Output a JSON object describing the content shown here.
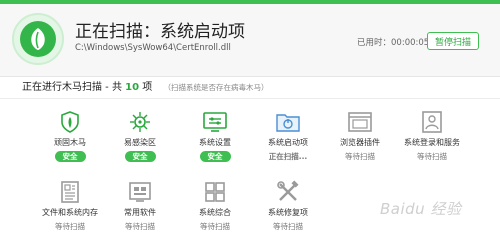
{
  "header": {
    "title": "正在扫描：系统启动项",
    "path": "C:\\Windows\\SysWow64\\CertEnroll.dll",
    "elapsed_label": "已用时：",
    "elapsed_time": "00:00:05",
    "pause_label": "暂停扫描",
    "accent_color": "#3fbf52"
  },
  "status": {
    "prefix": "正在进行木马扫描 - 共",
    "count": "10",
    "suffix": "项",
    "note": "（扫描系统是否存在病毒木马）"
  },
  "items": [
    {
      "label": "顽固木马",
      "status": "安全",
      "state": "safe",
      "icon": "shield-icon"
    },
    {
      "label": "易感染区",
      "status": "安全",
      "state": "safe",
      "icon": "virus-icon"
    },
    {
      "label": "系统设置",
      "status": "安全",
      "state": "safe",
      "icon": "settings-panel-icon"
    },
    {
      "label": "系统启动项",
      "status": "正在扫描...",
      "state": "scanning",
      "icon": "startup-folder-icon"
    },
    {
      "label": "浏览器插件",
      "status": "等待扫描",
      "state": "waiting",
      "icon": "browser-window-icon"
    },
    {
      "label": "系统登录和服务",
      "status": "等待扫描",
      "state": "waiting",
      "icon": "user-login-icon"
    },
    {
      "label": "文件和系统内存",
      "status": "等待扫描",
      "state": "waiting",
      "icon": "document-icon"
    },
    {
      "label": "常用软件",
      "status": "等待扫描",
      "state": "waiting",
      "icon": "software-icon"
    },
    {
      "label": "系统综合",
      "status": "等待扫描",
      "state": "waiting",
      "icon": "windows-icon"
    },
    {
      "label": "系统修复项",
      "status": "等待扫描",
      "state": "waiting",
      "icon": "tools-icon"
    }
  ],
  "watermark": "Baidu 经验"
}
